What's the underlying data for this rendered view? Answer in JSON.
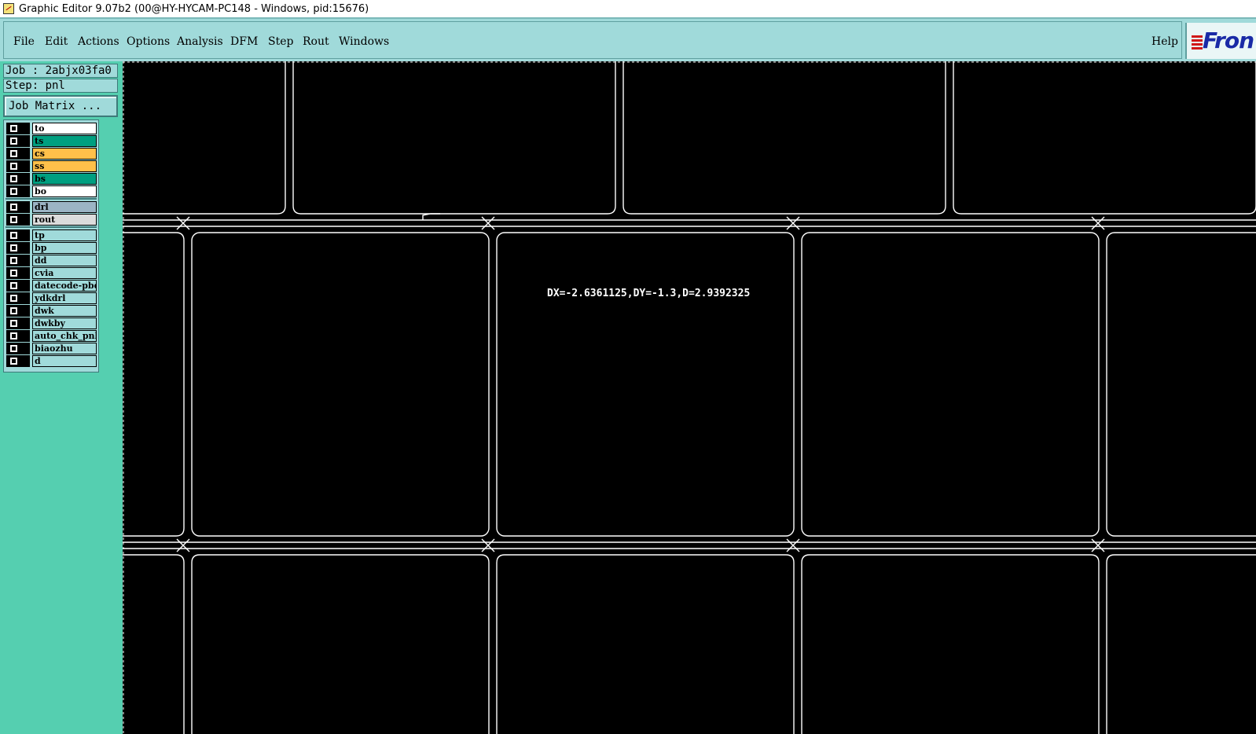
{
  "window": {
    "title": "Graphic Editor 9.07b2 (00@HY-HYCAM-PC148 - Windows, pid:15676)"
  },
  "menu": {
    "items": [
      "File",
      "Edit",
      "Actions",
      "Options",
      "Analysis",
      "DFM",
      "Step",
      "Rout",
      "Windows"
    ],
    "help": "Help",
    "logo_text": "Fron"
  },
  "panel": {
    "job": "Job : 2abjx03fa0",
    "step": "Step: pnl",
    "job_matrix": "Job Matrix ..."
  },
  "layers": [
    {
      "name": "to",
      "color": "#ffffff"
    },
    {
      "name": "ts",
      "color": "#009f80"
    },
    {
      "name": "cs",
      "color": "#ffc04a"
    },
    {
      "name": "ss",
      "color": "#ffc04a"
    },
    {
      "name": "bs",
      "color": "#009f80"
    },
    {
      "name": "bo",
      "color": "#ffffff"
    },
    {
      "name": "drl",
      "color": "#9cb4c4"
    },
    {
      "name": "rout",
      "color": "#dcdcdc"
    },
    {
      "name": "tp",
      "color": "#a0dada"
    },
    {
      "name": "bp",
      "color": "#a0dada"
    },
    {
      "name": "dd",
      "color": "#a0dada"
    },
    {
      "name": "cvia",
      "color": "#a0dada"
    },
    {
      "name": "datecode-pbe",
      "color": "#a0dada"
    },
    {
      "name": "ydkdrl",
      "color": "#a0dada"
    },
    {
      "name": "dwk",
      "color": "#a0dada"
    },
    {
      "name": "dwkby",
      "color": "#a0dada"
    },
    {
      "name": "auto_chk_pnl",
      "color": "#a0dada"
    },
    {
      "name": "biaozhu",
      "color": "#a0dada"
    },
    {
      "name": "d",
      "color": "#a0dada"
    }
  ],
  "canvas": {
    "measurement": "DX=-2.6361125,DY=-1.3,D=2.9392325"
  }
}
